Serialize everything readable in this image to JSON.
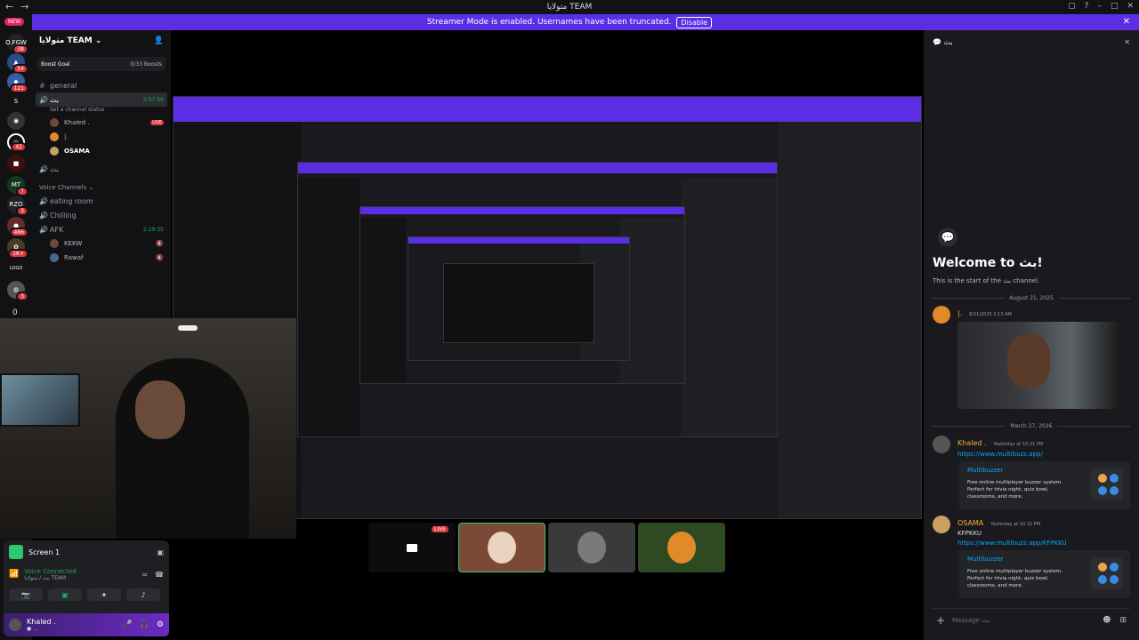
{
  "window": {
    "title": "متولايا TEAM",
    "nav_back": "←",
    "nav_forward": "→",
    "controls": [
      "▢",
      "?",
      "–",
      "□",
      "✕"
    ]
  },
  "banner": {
    "text": "Streamer Mode is enabled. Usernames have been truncated.",
    "disable": "Disable"
  },
  "rail": {
    "new_label": "NEW",
    "servers": [
      {
        "label": "O.FGW",
        "badge": "38"
      },
      {
        "label": "▲",
        "badge": "54"
      },
      {
        "label": "◆",
        "badge": "121"
      },
      {
        "label": "S",
        "badge": ""
      },
      {
        "label": "◉",
        "badge": ""
      },
      {
        "label": "◎",
        "badge": "41"
      },
      {
        "label": "■",
        "badge": ""
      },
      {
        "label": "MT",
        "badge": "7"
      },
      {
        "label": "RZQ",
        "badge": "3"
      },
      {
        "label": "●",
        "badge": "466"
      },
      {
        "label": "✿",
        "badge": "1K+"
      },
      {
        "label": "LOGO",
        "badge": ""
      },
      {
        "label": "◍",
        "badge": "3"
      }
    ],
    "bottom_count": "0"
  },
  "sidebar": {
    "guild_name": "متولايا TEAM",
    "boost_label": "Boost Goal",
    "boost_count": "0/33 Boosts",
    "general": "general",
    "active_channel": "بث",
    "active_time": "5:57:56",
    "channel_status": "Set a channel status",
    "users": [
      {
        "name": "Khaled .",
        "tag": "LIVE"
      },
      {
        "name": "|.",
        "tag": ""
      },
      {
        "name": "OSAMA",
        "tag": ""
      }
    ],
    "channel_2": "بث",
    "category": "Voice Channels",
    "voice_channels": [
      "eating room",
      "Chilling"
    ],
    "afk": "AFK",
    "afk_time": "2:29:35",
    "afk_users": [
      "KEKW",
      "Rawaf"
    ]
  },
  "stage": {
    "live_tag": "LIVE"
  },
  "voice_panel": {
    "screen_label": "Screen 1",
    "connected": "Voice Connected",
    "location": "بث / متولايا TEAM",
    "username": "Khaled .",
    "status": "● ..."
  },
  "chat": {
    "channel": "بث",
    "welcome_title": "Welcome to بث!",
    "welcome_sub": "This is the start of the بث channel.",
    "date1": "August 21, 2025",
    "msg1_name": "|.",
    "msg1_time": "8/21/2025 2:13 AM",
    "date2": "March 27, 2026",
    "msg2_name": "Khaled .",
    "msg2_time": "Yesterday at 10:31 PM",
    "msg2_link": "https://www.multibuzz.app/",
    "embed_title": "Multibuzzer",
    "embed_desc": "Free online multiplayer buzzer system. Perfect for trivia night, quiz bowl, classrooms, and more.",
    "msg3_name": "OSAMA",
    "msg3_time": "Yesterday at 10:32 PM",
    "msg3_text": "KFPKKU",
    "msg3_link": "https://www.multibuzz.app/KFPKKU",
    "input_placeholder": "Message بث"
  }
}
